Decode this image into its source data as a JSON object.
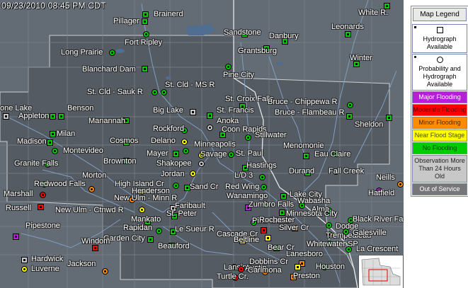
{
  "timestamp": "09/23/2010 08:45 PM CDT",
  "colors": {
    "major": "#b51fd6",
    "moderate": "#ff0000",
    "minor": "#ff8c00",
    "near": "#ffff00",
    "none": "#00cc00",
    "old": "#c8c8c8",
    "service": "#777777"
  },
  "legend": {
    "title": "Map Legend",
    "hydrograph": "Hydrograph Available",
    "probability": "Probability and Hydrograph Available",
    "major": "Major Flooding",
    "moderate": "Moderate Flooding",
    "minor": "Minor Flooding",
    "near": "Near Flood Stage",
    "none": "No Flooding",
    "old": "Observation More Than 24 Hours Old",
    "service": "Out of Service"
  },
  "sites": [
    {
      "name": "Brainerd",
      "status": "none",
      "icon": "hyd"
    },
    {
      "name": "White R.",
      "status": "none",
      "icon": "hyd"
    },
    {
      "name": "Pillager",
      "status": "none",
      "icon": "hyd"
    },
    {
      "name": "Fort Ripley",
      "status": "none",
      "icon": "prob"
    },
    {
      "name": "Sandstone",
      "status": "none",
      "icon": "hyd"
    },
    {
      "name": "Danbury",
      "status": "none",
      "icon": "hyd"
    },
    {
      "name": "Leonards",
      "status": "none",
      "icon": "hyd"
    },
    {
      "name": "Long Prairie",
      "status": "none",
      "icon": "prob"
    },
    {
      "name": "Grantsburg",
      "status": "none",
      "icon": "hyd"
    },
    {
      "name": "Winter",
      "status": "none",
      "icon": "hyd"
    },
    {
      "name": "Blanchard Dam",
      "status": "none",
      "icon": "hyd"
    },
    {
      "name": "Pine City",
      "status": "none",
      "icon": "prob"
    },
    {
      "name": "St. Cld - Sauk R",
      "status": "none",
      "icon": "prob"
    },
    {
      "name": "St. Cld - MS R",
      "status": "none",
      "icon": "prob"
    },
    {
      "name": "St. Croix Falls",
      "status": "none",
      "icon": "hyd"
    },
    {
      "name": "one Lake",
      "status": "old",
      "icon": "hyd"
    },
    {
      "name": "Benson",
      "status": "none",
      "icon": "hyd"
    },
    {
      "name": "Bruce - Chippewa R",
      "status": "none",
      "icon": "prob"
    },
    {
      "name": "Appleton",
      "status": "none",
      "icon": "hyd"
    },
    {
      "name": "Big Lake",
      "status": "old",
      "icon": "hyd"
    },
    {
      "name": "St. Francis",
      "status": "none",
      "icon": "hyd"
    },
    {
      "name": "Bruce - Flambeau R",
      "status": "none",
      "icon": "hyd"
    },
    {
      "name": "Manannah",
      "status": "none",
      "icon": "hyd"
    },
    {
      "name": "Anoka",
      "status": "old",
      "icon": "prob"
    },
    {
      "name": "Rockford",
      "status": "none",
      "icon": "prob"
    },
    {
      "name": "Coon Rapids",
      "status": "none",
      "icon": "hyd"
    },
    {
      "name": "Sheldon",
      "status": "none",
      "icon": "hyd"
    },
    {
      "name": "Milan",
      "status": "none",
      "icon": "hyd"
    },
    {
      "name": "Stillwater",
      "status": "none",
      "icon": "prob"
    },
    {
      "name": "Madison",
      "status": "none",
      "icon": "hyd"
    },
    {
      "name": "Cosmos",
      "status": "none",
      "icon": "hyd"
    },
    {
      "name": "Delano",
      "status": "near",
      "icon": "prob"
    },
    {
      "name": "Minneapolis",
      "status": "none",
      "icon": "prob"
    },
    {
      "name": "Menomonie",
      "status": "none",
      "icon": "hyd"
    },
    {
      "name": "Montevideo",
      "status": "none",
      "icon": "prob"
    },
    {
      "name": "Mayer",
      "status": "none",
      "icon": "hyd"
    },
    {
      "name": "Savage",
      "status": "near",
      "icon": "prob"
    },
    {
      "name": "St. Paul",
      "status": "none",
      "icon": "prob"
    },
    {
      "name": "Eau Claire",
      "status": "none",
      "icon": "prob"
    },
    {
      "name": "Granite Falls",
      "status": "none",
      "icon": "prob"
    },
    {
      "name": "Brownton",
      "status": "none",
      "icon": "hyd"
    },
    {
      "name": "Shakopee",
      "status": "old",
      "icon": "prob"
    },
    {
      "name": "Hastings",
      "status": "none",
      "icon": "hyd"
    },
    {
      "name": "Jordan",
      "status": "near",
      "icon": "prob"
    },
    {
      "name": "Durand",
      "status": "none",
      "icon": "hyd"
    },
    {
      "name": "Fall Creek",
      "status": "none",
      "icon": "prob"
    },
    {
      "name": "Morton",
      "status": "minor",
      "icon": "prob"
    },
    {
      "name": "L/D 3",
      "status": "none",
      "icon": "prob"
    },
    {
      "name": "Neills",
      "status": "minor",
      "icon": "prob"
    },
    {
      "name": "Redwood Falls",
      "status": "none",
      "icon": "prob"
    },
    {
      "name": "High Island Cr",
      "status": "none",
      "icon": "prob"
    },
    {
      "name": "Sand Cr",
      "status": "none",
      "icon": "hyd"
    },
    {
      "name": "Red Wing",
      "status": "none",
      "icon": "prob"
    },
    {
      "name": "Marshall",
      "status": "moderate",
      "icon": "prob"
    },
    {
      "name": "Henderson",
      "status": "near",
      "icon": "prob"
    },
    {
      "name": "Hatfield",
      "status": "major",
      "icon": "prob"
    },
    {
      "name": "Wanamingo",
      "status": "major",
      "icon": "hyd"
    },
    {
      "name": "Lake City",
      "status": "none",
      "icon": "hyd"
    },
    {
      "name": "Russell",
      "status": "moderate",
      "icon": "hyd"
    },
    {
      "name": "New Ulm - Minn R",
      "status": "minor",
      "icon": "prob"
    },
    {
      "name": "Zumbro Falls",
      "status": "none",
      "icon": "prob"
    },
    {
      "name": "Wabasha",
      "status": "none",
      "icon": "prob"
    },
    {
      "name": "New Ulm - Ctnwd R",
      "status": "near",
      "icon": "prob"
    },
    {
      "name": "Faribault",
      "status": "old",
      "icon": "hyd"
    },
    {
      "name": "Alma",
      "status": "none",
      "icon": "prob"
    },
    {
      "name": "St. Peter",
      "status": "none",
      "icon": "hyd"
    },
    {
      "name": "Minnesota City",
      "status": "none",
      "icon": "hyd"
    },
    {
      "name": "Mankato",
      "status": "none",
      "icon": "hyd"
    },
    {
      "name": "Pine Island",
      "status": "none",
      "icon": "prob"
    },
    {
      "name": "Black River Fa",
      "status": "none",
      "icon": "prob"
    },
    {
      "name": "Rochester",
      "status": "moderate",
      "icon": "hyd"
    },
    {
      "name": "Dodge",
      "status": "none",
      "icon": "prob"
    },
    {
      "name": "Rapidan",
      "status": "none",
      "icon": "prob"
    },
    {
      "name": "Le Sueur R",
      "status": "none",
      "icon": "hyd"
    },
    {
      "name": "Silver Cr",
      "status": "minor",
      "icon": "hyd"
    },
    {
      "name": "Trempealeau",
      "status": "none",
      "icon": "prob"
    },
    {
      "name": "Galesville",
      "status": "none",
      "icon": "prob"
    },
    {
      "name": "Garden City",
      "status": "none",
      "icon": "hyd"
    },
    {
      "name": "Cascade Cr",
      "status": "near",
      "icon": "hyd"
    },
    {
      "name": "Pipestone",
      "status": "major",
      "icon": "hyd"
    },
    {
      "name": "Windom",
      "status": "moderate",
      "icon": "hyd"
    },
    {
      "name": "Beltline",
      "status": "near",
      "icon": "hyd"
    },
    {
      "name": "Whitewater SP",
      "status": "none",
      "icon": "prob"
    },
    {
      "name": "Beauford",
      "status": "none",
      "icon": "hyd"
    },
    {
      "name": "Bear Cr",
      "status": "none",
      "icon": "hyd"
    },
    {
      "name": "La Crescent",
      "status": "none",
      "icon": "prob"
    },
    {
      "name": "Lanesboro",
      "status": "minor",
      "icon": "hyd"
    },
    {
      "name": "Hardwick",
      "status": "old",
      "icon": "hyd"
    },
    {
      "name": "Lansing",
      "status": "moderate",
      "icon": "prob"
    },
    {
      "name": "Jackson",
      "status": "minor",
      "icon": "prob"
    },
    {
      "name": "Dobbins Cr",
      "status": "near",
      "icon": "hyd"
    },
    {
      "name": "Houston",
      "status": "none",
      "icon": "prob"
    },
    {
      "name": "Luverne",
      "status": "near",
      "icon": "prob"
    },
    {
      "name": "Austin",
      "status": "moderate",
      "icon": "prob"
    },
    {
      "name": "Carimona",
      "status": "minor",
      "icon": "prob"
    },
    {
      "name": "Preston",
      "status": "minor",
      "icon": "hyd"
    },
    {
      "name": "Turtle Cr.",
      "status": "moderate",
      "icon": "prob"
    }
  ]
}
